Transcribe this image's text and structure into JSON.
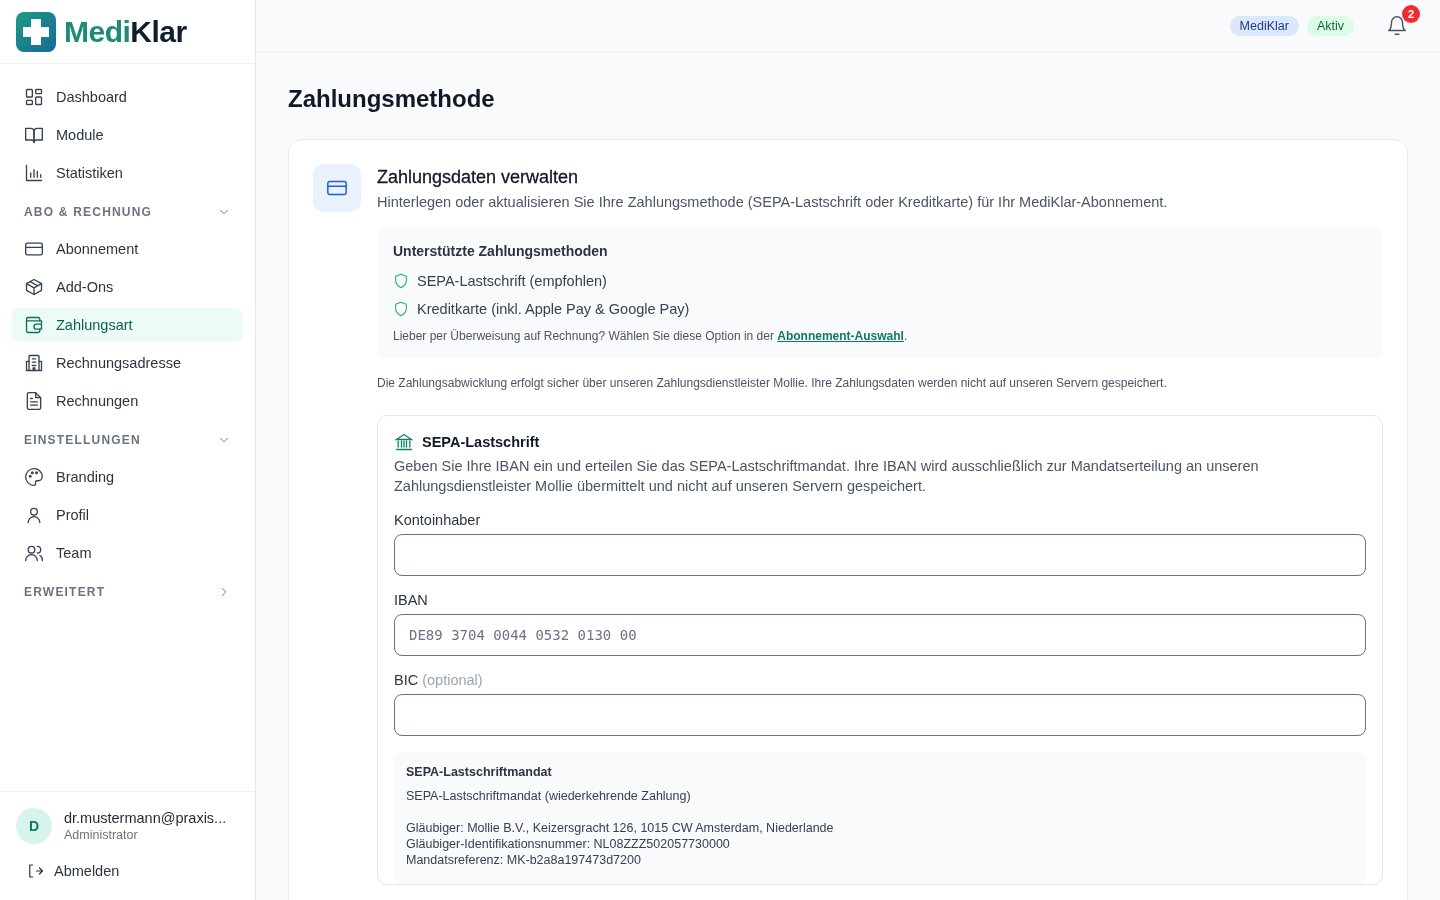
{
  "sidebar": {
    "logo": {
      "part_1": "Medi",
      "part_2": "Klar"
    },
    "items": [
      {
        "label": "Dashboard",
        "kind": "grid",
        "selected": false
      },
      {
        "label": "Module",
        "kind": "book",
        "selected": false
      },
      {
        "label": "Statistiken",
        "kind": "chart",
        "selected": false
      }
    ],
    "sections": [
      {
        "title": "ABO & RECHNUNG",
        "expanded": true,
        "items": [
          {
            "label": "Abonnement",
            "kind": "card",
            "selected": false
          },
          {
            "label": "Add-Ons",
            "kind": "box",
            "selected": false
          },
          {
            "label": "Zahlungsart",
            "kind": "wallet",
            "selected": true
          },
          {
            "label": "Rechnungsadresse",
            "kind": "building",
            "selected": false
          },
          {
            "label": "Rechnungen",
            "kind": "file",
            "selected": false
          }
        ]
      },
      {
        "title": "EINSTELLUNGEN",
        "expanded": true,
        "items": [
          {
            "label": "Branding",
            "kind": "palette",
            "selected": false
          },
          {
            "label": "Profil",
            "kind": "user",
            "selected": false
          },
          {
            "label": "Team",
            "kind": "users",
            "selected": false
          }
        ]
      },
      {
        "title": "ERWEITERT",
        "expanded": false
      }
    ],
    "user": {
      "initial": "D",
      "email": "dr.mustermann@praxis...",
      "role": "Administrator"
    },
    "logout": "Abmelden"
  },
  "topbar": {
    "badges": [
      {
        "label": "MediKlar",
        "color": "#dbe7fb"
      },
      {
        "label": "Aktiv",
        "color": "#dcfce7"
      }
    ],
    "notifications": "2"
  },
  "page_title": "Zahlungsmethode",
  "card": {
    "title": "Zahlungsdaten verwalten",
    "description": "Hinterlegen oder aktualisieren Sie Ihre Zahlungsmethode (SEPA-Lastschrift oder Kreditkarte) für Ihr MediKlar-Abonnement.",
    "supported": {
      "title": "Unterstützte Zahlungsmethoden",
      "methods": [
        "SEPA-Lastschrift (empfohlen)",
        "Kreditkarte (inkl. Apple Pay & Google Pay)"
      ],
      "note": "Lieber per Überweisung auf Rechnung? Wählen Sie diese Option in der ",
      "link": "Abonnement-Auswahl",
      "note_end": "."
    },
    "security_note": "Die Zahlungsabwicklung erfolgt sicher über unseren Zahlungsdienstleister Mollie. Ihre Zahlungsdaten werden nicht auf unseren Servern gespeichert.",
    "sepa": {
      "title": "SEPA-Lastschrift",
      "description": "Geben Sie Ihre IBAN ein und erteilen Sie das SEPA-Lastschriftmandat. Ihre IBAN wird ausschließlich zur Mandatserteilung an unseren Zahlungsdienstleister Mollie übermittelt und nicht auf unseren Servern gespeichert.",
      "fields": [
        {
          "label": "Kontoinhaber"
        },
        {
          "label": "IBAN",
          "placeholder": "DE89 3704 0044 0532 0130 00"
        },
        {
          "label": "BIC",
          "hint": "(optional)"
        }
      ],
      "mandate": {
        "title": "SEPA-Lastschriftmandat",
        "subtitle": "SEPA-Lastschriftmandat (wiederkehrende Zahlung)",
        "lines": [
          "Gläubiger: Mollie B.V., Keizersgracht 126, 1015 CW Amsterdam, Niederlande",
          "Gläubiger-Identifikationsnummer: NL08ZZZ502057730000",
          "Mandatsreferenz: MK-b2a8a197473d7200"
        ]
      }
    }
  }
}
